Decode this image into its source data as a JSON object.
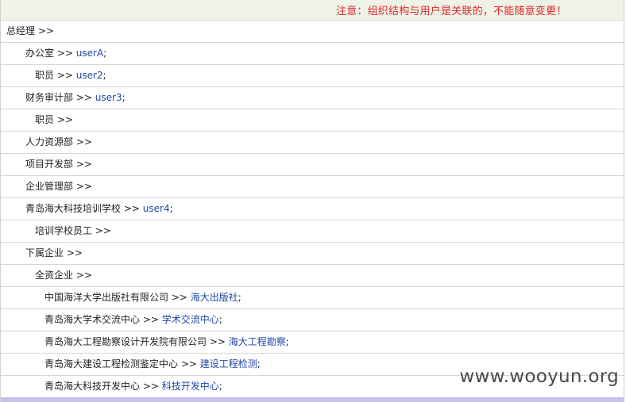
{
  "notice": "注意：组织结构与用户是关联的，不能随意变更！",
  "tree": [
    {
      "level": 0,
      "name": "总经理",
      "sep": " >> ",
      "users": ""
    },
    {
      "level": 1,
      "name": "办公室",
      "sep": " >> ",
      "users": "userA",
      "tail": ";"
    },
    {
      "level": 2,
      "name": "职员",
      "sep": " >> ",
      "users": "user2",
      "tail": ";"
    },
    {
      "level": 1,
      "name": "财务审计部",
      "sep": " >> ",
      "users": "user3",
      "tail": ";"
    },
    {
      "level": 2,
      "name": "职员",
      "sep": " >> ",
      "users": ""
    },
    {
      "level": 1,
      "name": "人力资源部",
      "sep": " >> ",
      "users": ""
    },
    {
      "level": 1,
      "name": "项目开发部",
      "sep": " >> ",
      "users": ""
    },
    {
      "level": 1,
      "name": "企业管理部",
      "sep": " >> ",
      "users": ""
    },
    {
      "level": 1,
      "name": "青岛海大科技培训学校",
      "sep": " >> ",
      "users": "user4",
      "tail": ";"
    },
    {
      "level": 2,
      "name": "培训学校员工",
      "sep": " >> ",
      "users": ""
    },
    {
      "level": 1,
      "name": "下属企业",
      "sep": " >> ",
      "users": ""
    },
    {
      "level": 2,
      "name": "全资企业",
      "sep": " >> ",
      "users": ""
    },
    {
      "level": 3,
      "name": "中国海洋大学出版社有限公司",
      "sep": " >> ",
      "users": "海大出版社",
      "tail": ";"
    },
    {
      "level": 3,
      "name": "青岛海大学术交流中心",
      "sep": " >> ",
      "users": "学术交流中心",
      "tail": ";"
    },
    {
      "level": 3,
      "name": "青岛海大工程勘察设计开发院有限公司",
      "sep": " >> ",
      "users": "海大工程勘察",
      "tail": ";"
    },
    {
      "level": 3,
      "name": "青岛海大建设工程检测鉴定中心",
      "sep": " >> ",
      "users": "建设工程检测",
      "tail": ";"
    },
    {
      "level": 3,
      "name": "青岛海大科技开发中心",
      "sep": " >> ",
      "users": "科技开发中心",
      "tail": ";"
    }
  ],
  "watermark": "www.wooyun.org",
  "colors": {
    "notice": "#e0262b",
    "link": "#1f47a8",
    "header_bg": "#eef3e6",
    "row_border": "#d4d8cc",
    "bottom_bar": "#c5c3ee"
  }
}
